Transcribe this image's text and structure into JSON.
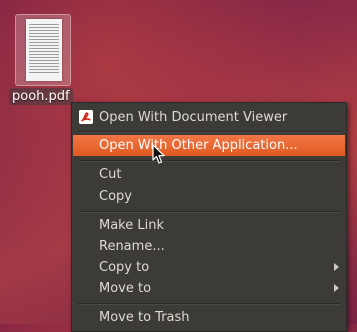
{
  "desktop": {
    "file_icon": {
      "label": "pooh.pdf",
      "icon": "pdf-thumbnail-icon"
    }
  },
  "context_menu": {
    "items": [
      {
        "label": "Open With Document Viewer",
        "icon": "document-viewer-icon"
      },
      {
        "label": "Open With Other Application...",
        "highlighted": true
      },
      {
        "label": "Cut"
      },
      {
        "label": "Copy"
      },
      {
        "label": "Make Link"
      },
      {
        "label": "Rename..."
      },
      {
        "label": "Copy to",
        "submenu": true
      },
      {
        "label": "Move to",
        "submenu": true
      },
      {
        "label": "Move to Trash"
      }
    ]
  },
  "colors": {
    "menu_background": "#3c3b37",
    "menu_text": "#dfdbd2",
    "highlight": "#e9662c",
    "desktop": "#8d2b48"
  }
}
